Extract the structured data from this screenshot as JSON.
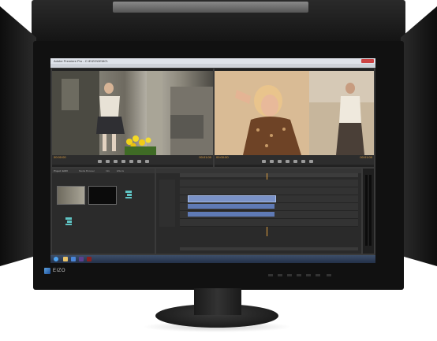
{
  "window": {
    "title": "Adobe Premiere Pro - C:\\EIZO\\DEMO\\"
  },
  "source_monitor": {
    "timecode_in": "00:00:00",
    "timecode_out": "00:01:00"
  },
  "program_monitor": {
    "timecode_in": "00:00:00",
    "timecode_out": "00:01:00"
  },
  "project_panel": {
    "tabs": [
      "Project: EIZO",
      "Media Browser",
      "Info",
      "Effects"
    ]
  },
  "brand": {
    "name": "EIZO",
    "accent": "#2a6fd0"
  },
  "colors": {
    "video_clip": "#7b93c8",
    "audio_clip": "#5f7ab5",
    "timecode": "#e0a040"
  }
}
